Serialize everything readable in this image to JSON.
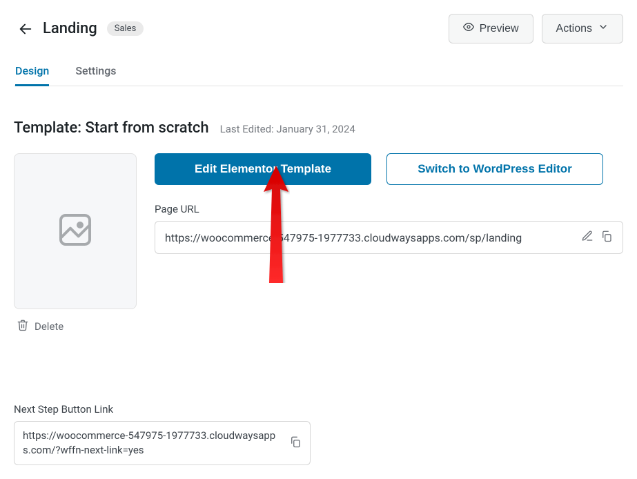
{
  "header": {
    "title": "Landing",
    "badge": "Sales",
    "preview_label": "Preview",
    "actions_label": "Actions"
  },
  "tabs": {
    "design": "Design",
    "settings": "Settings",
    "active": "design"
  },
  "template": {
    "title": "Template: Start from scratch",
    "last_edited": "Last Edited: January 31, 2024",
    "delete_label": "Delete",
    "edit_button": "Edit Elementor Template",
    "switch_button": "Switch to WordPress Editor"
  },
  "page_url": {
    "label": "Page URL",
    "value": "https://woocommerce-547975-1977733.cloudwaysapps.com/sp/landing"
  },
  "next_step": {
    "label": "Next Step Button Link",
    "value": "https://woocommerce-547975-1977733.cloudwaysapps.com/?wffn-next-link=yes"
  }
}
